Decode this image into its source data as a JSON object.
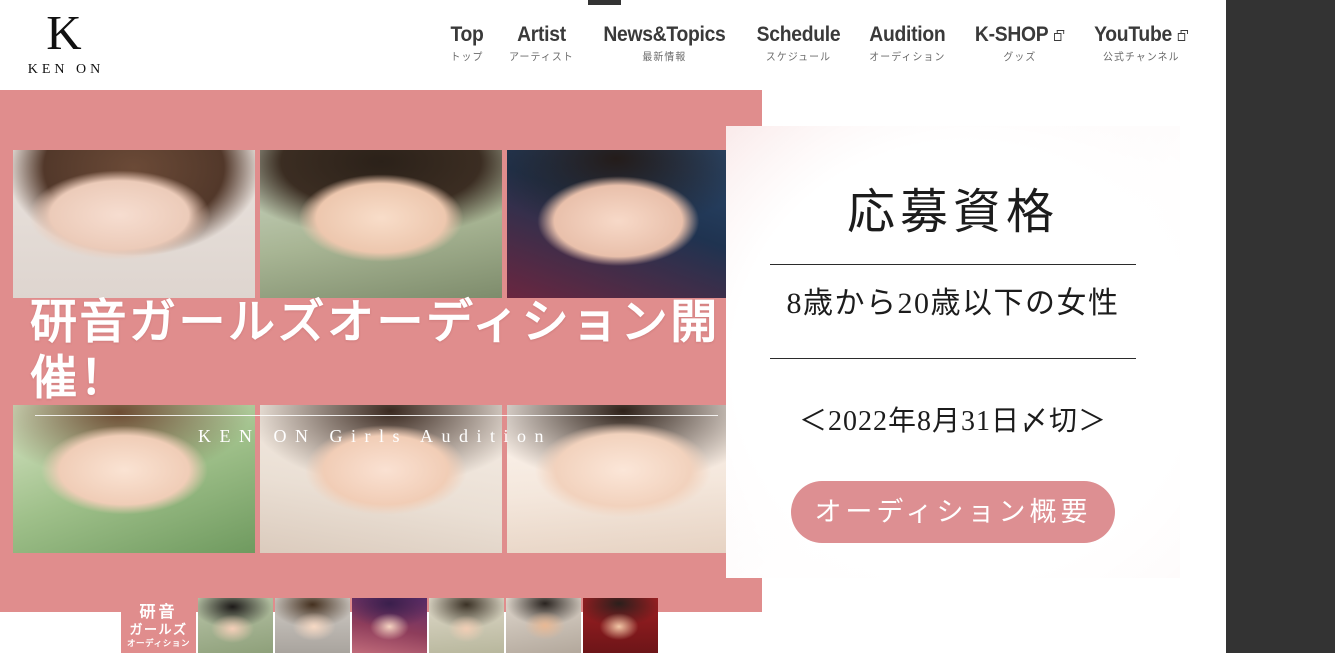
{
  "site": {
    "logo_mark": "K",
    "logo_word": "KEN ON"
  },
  "nav": {
    "items": [
      {
        "en": "Top",
        "jp": "トップ",
        "external": false
      },
      {
        "en": "Artist",
        "jp": "アーティスト",
        "external": false
      },
      {
        "en": "News&Topics",
        "jp": "最新情報",
        "external": false
      },
      {
        "en": "Schedule",
        "jp": "スケジュール",
        "external": false
      },
      {
        "en": "Audition",
        "jp": "オーディション",
        "external": false
      },
      {
        "en": "K-SHOP",
        "jp": "グッズ",
        "external": true
      },
      {
        "en": "YouTube",
        "jp": "公式チャンネル",
        "external": true
      }
    ]
  },
  "hero": {
    "title_jp": "研音ガールズオーディション開催！",
    "title_en": "KEN ON Girls Audition",
    "background_color": "#e08d8d",
    "photos_top": [
      "portrait-1",
      "portrait-2",
      "portrait-3"
    ],
    "photos_bottom": [
      "portrait-4",
      "portrait-5",
      "portrait-6"
    ]
  },
  "card": {
    "title": "応募資格",
    "requirement": "8歳から20歳以下の女性",
    "deadline": "＜2022年8月31日〆切＞",
    "cta_label": "オーディション概要",
    "cta_color": "#dd8f92"
  },
  "thumbnails": {
    "active": {
      "line1": "研音",
      "line2": "ガールズ",
      "line3": "オーディション"
    },
    "items": [
      {
        "name": "thumb-1"
      },
      {
        "name": "thumb-2"
      },
      {
        "name": "thumb-3"
      },
      {
        "name": "thumb-4"
      },
      {
        "name": "thumb-5"
      },
      {
        "name": "thumb-6"
      }
    ]
  }
}
